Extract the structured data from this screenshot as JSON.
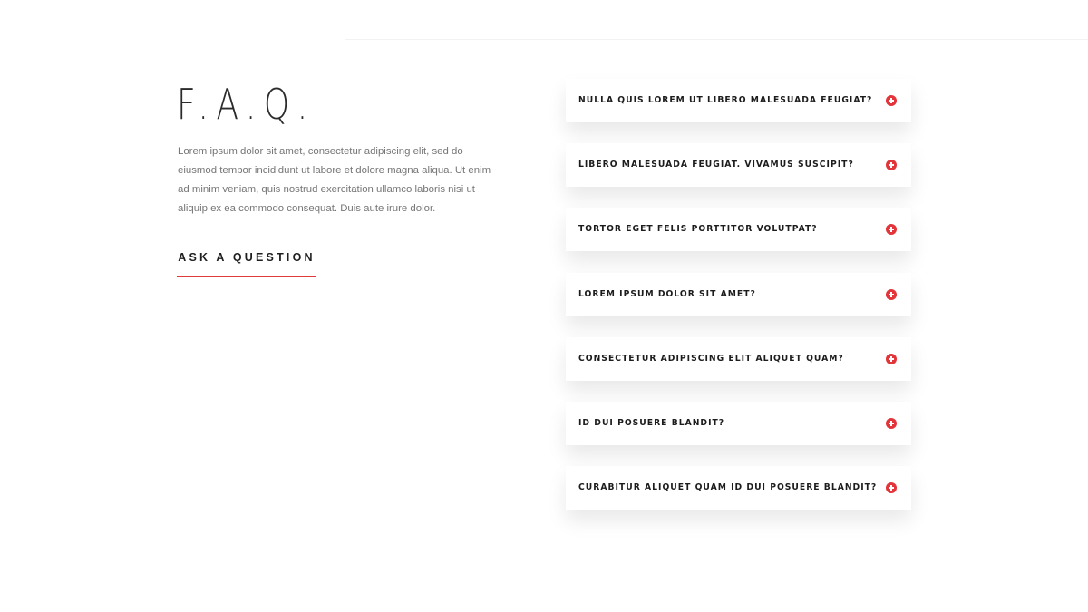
{
  "faq": {
    "title": "F.A.Q.",
    "intro": "Lorem ipsum dolor sit amet, consectetur adipiscing elit, sed do eiusmod tempor incididunt ut labore et dolore magna aliqua. Ut enim ad minim veniam, quis nostrud exercitation ullamco laboris nisi ut aliquip ex ea commodo consequat. Duis aute irure dolor.",
    "ask_button": "ASK A QUESTION",
    "accent_color": "#e3343a",
    "items": [
      {
        "question": "NULLA QUIS LOREM UT LIBERO MALESUADA FEUGIAT?",
        "icon": "plus-circle-icon"
      },
      {
        "question": "LIBERO MALESUADA FEUGIAT. VIVAMUS SUSCIPIT?",
        "icon": "plus-circle-icon"
      },
      {
        "question": "TORTOR EGET FELIS PORTTITOR VOLUTPAT?",
        "icon": "plus-circle-icon"
      },
      {
        "question": "LOREM IPSUM DOLOR SIT AMET?",
        "icon": "plus-circle-icon"
      },
      {
        "question": "CONSECTETUR ADIPISCING ELIT ALIQUET QUAM?",
        "icon": "plus-circle-icon"
      },
      {
        "question": "ID DUI POSUERE BLANDIT?",
        "icon": "plus-circle-icon"
      },
      {
        "question": "CURABITUR ALIQUET QUAM ID DUI POSUERE BLANDIT?",
        "icon": "plus-circle-icon"
      }
    ]
  }
}
